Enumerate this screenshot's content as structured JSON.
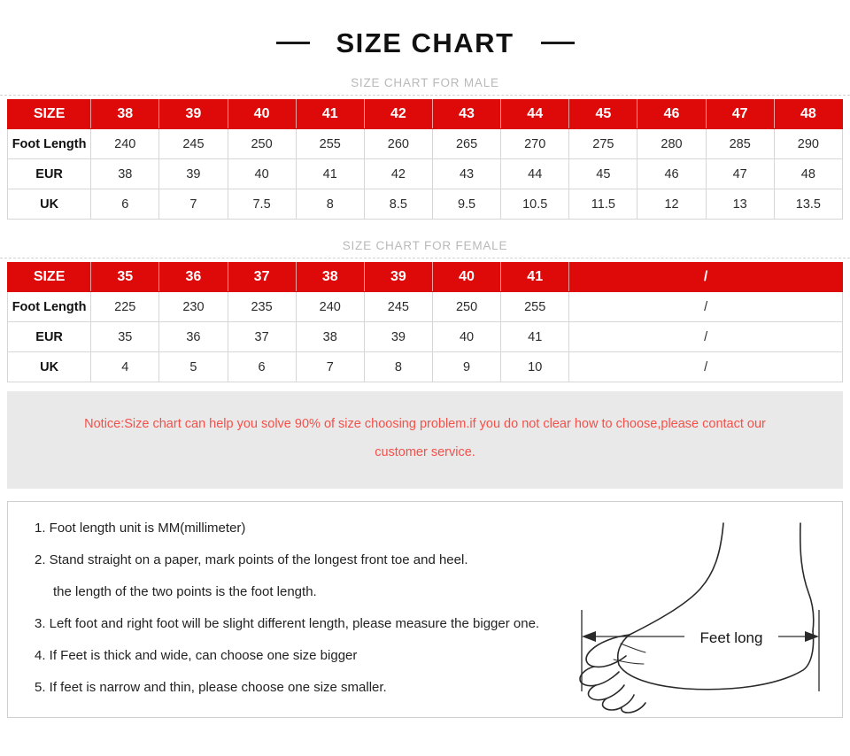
{
  "header": {
    "title": "SIZE CHART",
    "left_dash": "dash",
    "right_dash": "dash"
  },
  "male_section": {
    "label": "SIZE CHART FOR MALE",
    "columns": [
      "SIZE",
      "38",
      "39",
      "40",
      "41",
      "42",
      "43",
      "44",
      "45",
      "46",
      "47",
      "48"
    ],
    "rows": [
      {
        "label": "Foot Length",
        "values": [
          "240",
          "245",
          "250",
          "255",
          "260",
          "265",
          "270",
          "275",
          "280",
          "285",
          "290"
        ]
      },
      {
        "label": "EUR",
        "values": [
          "38",
          "39",
          "40",
          "41",
          "42",
          "43",
          "44",
          "45",
          "46",
          "47",
          "48"
        ]
      },
      {
        "label": "UK",
        "values": [
          "6",
          "7",
          "7.5",
          "8",
          "8.5",
          "9.5",
          "10.5",
          "11.5",
          "12",
          "13",
          "13.5"
        ]
      }
    ]
  },
  "female_section": {
    "label": "SIZE CHART FOR FEMALE",
    "columns": [
      "SIZE",
      "35",
      "36",
      "37",
      "38",
      "39",
      "40",
      "41"
    ],
    "merged_header": "/",
    "rows": [
      {
        "label": "Foot Length",
        "values": [
          "225",
          "230",
          "235",
          "240",
          "245",
          "250",
          "255"
        ],
        "merged": "/"
      },
      {
        "label": "EUR",
        "values": [
          "35",
          "36",
          "37",
          "38",
          "39",
          "40",
          "41"
        ],
        "merged": "/"
      },
      {
        "label": "UK",
        "values": [
          "4",
          "5",
          "6",
          "7",
          "8",
          "9",
          "10"
        ],
        "merged": "/"
      }
    ]
  },
  "notice": {
    "line1": "Notice:Size chart can help you solve 90% of size choosing problem.if you do not clear how to choose,please contact our",
    "line2": "customer service."
  },
  "instructions": {
    "items": [
      "1. Foot length unit is MM(millimeter)",
      "2. Stand straight on a paper, mark points of the longest front toe and heel.",
      "the length of the two points is the foot length.",
      "3. Left foot and right foot will be slight different length, please measure the bigger one.",
      "4. If Feet is thick and wide, can choose one size bigger",
      "5. If feet is narrow and thin, please choose one size smaller."
    ]
  },
  "figure": {
    "measure_label": "Feet long",
    "alt": "foot-side-view-diagram"
  },
  "colors": {
    "brand_red": "#de0a0a",
    "notice_red": "#f4504a",
    "notice_bg": "#e9e9e9",
    "grid": "#d6d6d6",
    "muted_label": "#b9b9b9"
  }
}
